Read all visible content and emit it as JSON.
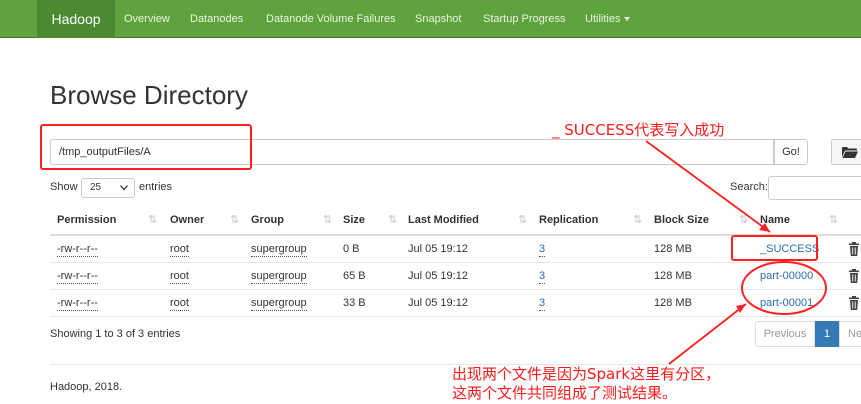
{
  "navbar": {
    "brand": "Hadoop",
    "items": [
      {
        "label": "Overview"
      },
      {
        "label": "Datanodes"
      },
      {
        "label": "Datanode Volume Failures"
      },
      {
        "label": "Snapshot"
      },
      {
        "label": "Startup Progress"
      },
      {
        "label": "Utilities"
      }
    ]
  },
  "page": {
    "title": "Browse Directory"
  },
  "path_bar": {
    "path": "/tmp_outputFiles/A",
    "go_label": "Go!"
  },
  "controls": {
    "show_label": "Show",
    "page_size": "25",
    "entries_label": "entries",
    "search_label": "Search:"
  },
  "table": {
    "columns": [
      "Permission",
      "Owner",
      "Group",
      "Size",
      "Last Modified",
      "Replication",
      "Block Size",
      "Name"
    ],
    "rows": [
      {
        "permission": "-rw-r--r--",
        "owner": "root",
        "group": "supergroup",
        "size": "0 B",
        "modified": "Jul 05 19:12",
        "replication": "3",
        "block_size": "128 MB",
        "name": "_SUCCESS"
      },
      {
        "permission": "-rw-r--r--",
        "owner": "root",
        "group": "supergroup",
        "size": "65 B",
        "modified": "Jul 05 19:12",
        "replication": "3",
        "block_size": "128 MB",
        "name": "part-00000"
      },
      {
        "permission": "-rw-r--r--",
        "owner": "root",
        "group": "supergroup",
        "size": "33 B",
        "modified": "Jul 05 19:12",
        "replication": "3",
        "block_size": "128 MB",
        "name": "part-00001"
      }
    ]
  },
  "table_info": "Showing 1 to 3 of 3 entries",
  "pagination": {
    "previous": "Previous",
    "current": "1",
    "next": "Ne"
  },
  "footer": "Hadoop, 2018.",
  "annotations": {
    "success_note": "_ SUCCESS代表写入成功",
    "partition_note_line1": "出现两个文件是因为Spark这里有分区，",
    "partition_note_line2": "这两个文件共同组成了测试结果。"
  },
  "colors": {
    "navbar": "#5fa33e",
    "brand_bg": "#4b8a30",
    "link": "#2a6db0",
    "annotation": "#ff1a1a",
    "page_active": "#337ab7"
  }
}
